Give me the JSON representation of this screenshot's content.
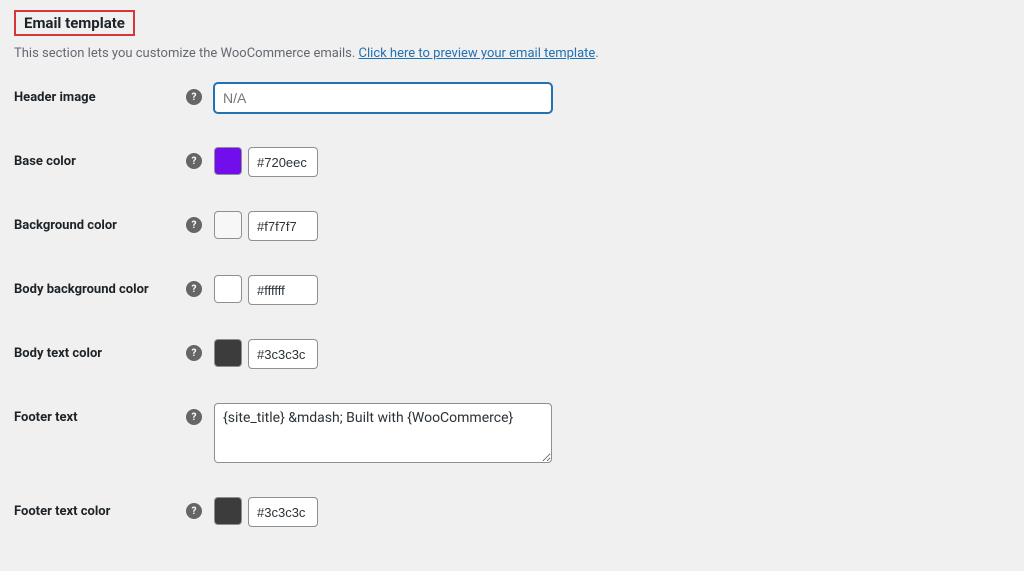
{
  "section": {
    "title": "Email template",
    "description_pre": "This section lets you customize the WooCommerce emails. ",
    "description_link": "Click here to preview your email template",
    "description_post": "."
  },
  "fields": {
    "header_image": {
      "label": "Header image",
      "placeholder": "N/A",
      "value": ""
    },
    "base_color": {
      "label": "Base color",
      "value": "#720eec",
      "swatch": "#720eec"
    },
    "background_color": {
      "label": "Background color",
      "value": "#f7f7f7",
      "swatch": "#f7f7f7"
    },
    "body_background_color": {
      "label": "Body background color",
      "value": "#ffffff",
      "swatch": "#ffffff"
    },
    "body_text_color": {
      "label": "Body text color",
      "value": "#3c3c3c",
      "swatch": "#3c3c3c"
    },
    "footer_text": {
      "label": "Footer text",
      "value": "{site_title} &mdash; Built with {WooCommerce}"
    },
    "footer_text_color": {
      "label": "Footer text color",
      "value": "#3c3c3c",
      "swatch": "#3c3c3c"
    }
  }
}
